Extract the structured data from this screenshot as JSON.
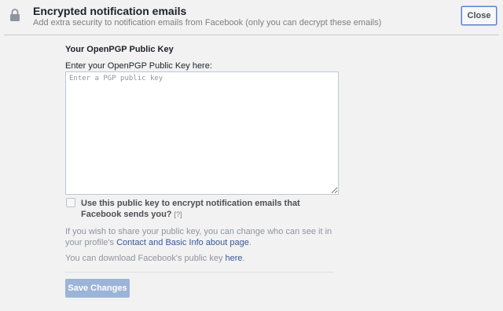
{
  "header": {
    "icon": "lock-icon",
    "title": "Encrypted notification emails",
    "subtitle": "Add extra security to notification emails from Facebook (only you can decrypt these emails)",
    "close_label": "Close"
  },
  "form": {
    "section_title": "Your OpenPGP Public Key",
    "field_label": "Enter your OpenPGP Public Key here:",
    "key_placeholder": "Enter a PGP public key",
    "key_value": "",
    "checkbox_checked": false,
    "checkbox_label": "Use this public key to encrypt notification emails that Facebook sends you?",
    "help_link": "[?]",
    "share_text_before": "If you wish to share your public key, you can change who can see it in your profile's",
    "share_link": "Contact and Basic Info about page",
    "share_text_after": ".",
    "download_text": "You can download Facebook's public key",
    "download_link": "here",
    "download_text_after": ".",
    "save_label": "Save Changes"
  },
  "colors": {
    "accent": "#365899",
    "save_button": "#9cb4d8",
    "background": "#f2f2f2"
  }
}
